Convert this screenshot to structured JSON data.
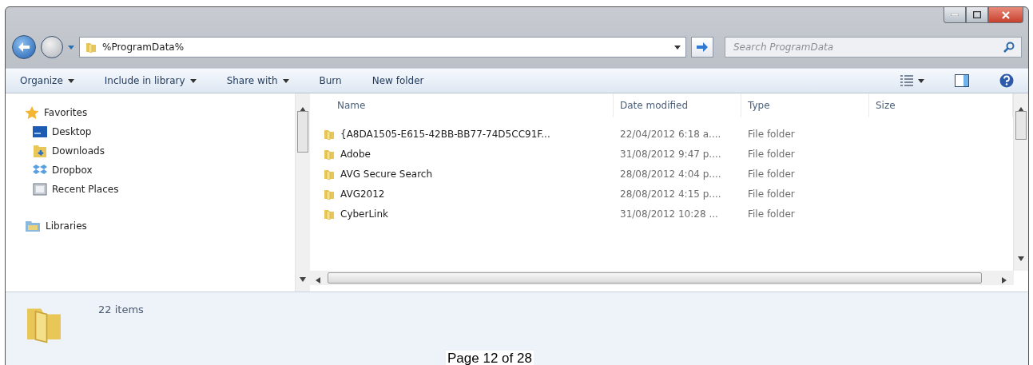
{
  "address_bar": {
    "path": "%ProgramData%"
  },
  "search": {
    "placeholder": "Search ProgramData"
  },
  "toolbar": {
    "items": [
      {
        "label": "Organize",
        "dropdown": true
      },
      {
        "label": "Include in library",
        "dropdown": true
      },
      {
        "label": "Share with",
        "dropdown": true
      },
      {
        "label": "Burn",
        "dropdown": false
      },
      {
        "label": "New folder",
        "dropdown": false
      }
    ]
  },
  "navigation": {
    "groups": [
      {
        "label": "Favorites",
        "children": [
          {
            "label": "Desktop"
          },
          {
            "label": "Downloads"
          },
          {
            "label": "Dropbox"
          },
          {
            "label": "Recent Places"
          }
        ]
      },
      {
        "label": "Libraries"
      }
    ]
  },
  "file_list": {
    "columns": [
      "Name",
      "Date modified",
      "Type",
      "Size"
    ],
    "rows": [
      {
        "name": "{A8DA1505-E615-42BB-BB77-74D5CC91F...",
        "date": "22/04/2012 6:18 a....",
        "type": "File folder"
      },
      {
        "name": "Adobe",
        "date": "31/08/2012 9:47 p....",
        "type": "File folder"
      },
      {
        "name": "AVG Secure Search",
        "date": "28/08/2012 4:04 p....",
        "type": "File folder"
      },
      {
        "name": "AVG2012",
        "date": "28/08/2012 4:15 p....",
        "type": "File folder"
      },
      {
        "name": "CyberLink",
        "date": "31/08/2012 10:28 ...",
        "type": "File folder"
      }
    ]
  },
  "details_pane": {
    "count": "22 items"
  },
  "page_footer": "Page 12 of 28"
}
